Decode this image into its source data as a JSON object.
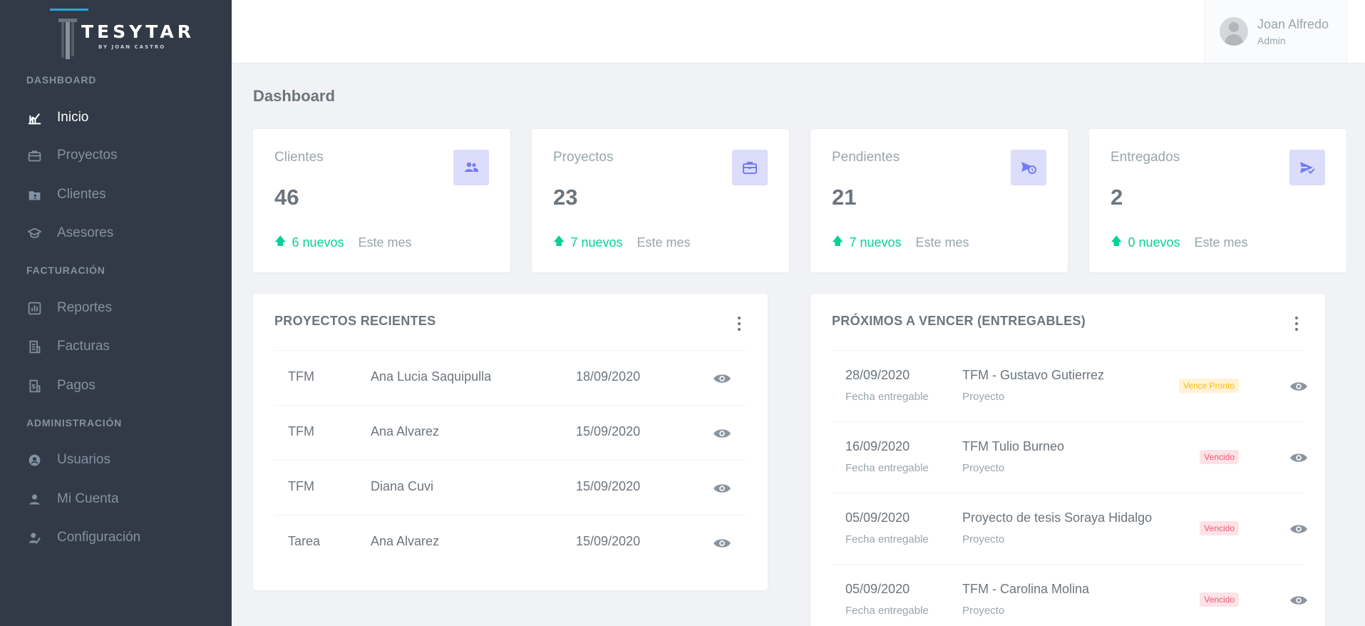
{
  "brand": {
    "name": "TESYTAR",
    "tagline": "BY JOAN CASTRO"
  },
  "sidebar": {
    "sections": [
      {
        "title": "DASHBOARD"
      },
      {
        "title": "FACTURACIÓN"
      },
      {
        "title": "ADMINISTRACIÓN"
      }
    ],
    "items": [
      {
        "label": "Inicio",
        "icon": "chart-icon",
        "active": true
      },
      {
        "label": "Proyectos",
        "icon": "briefcase-icon"
      },
      {
        "label": "Clientes",
        "icon": "folder-user-icon"
      },
      {
        "label": "Asesores",
        "icon": "graduation-cap-icon"
      },
      {
        "label": "Reportes",
        "icon": "bar-chart-icon"
      },
      {
        "label": "Facturas",
        "icon": "invoice-icon"
      },
      {
        "label": "Pagos",
        "icon": "payment-icon"
      },
      {
        "label": "Usuarios",
        "icon": "user-circle-icon"
      },
      {
        "label": "Mi Cuenta",
        "icon": "user-icon"
      },
      {
        "label": "Configuración",
        "icon": "user-settings-icon"
      }
    ]
  },
  "user": {
    "name": "Joan Alfredo",
    "role": "Admin"
  },
  "page": {
    "title": "Dashboard"
  },
  "stats": [
    {
      "label": "Clientes",
      "value": "46",
      "delta": "6 nuevos",
      "period": "Este mes",
      "icon": "users-icon"
    },
    {
      "label": "Proyectos",
      "value": "23",
      "delta": "7 nuevos",
      "period": "Este mes",
      "icon": "briefcase-icon"
    },
    {
      "label": "Pendientes",
      "value": "21",
      "delta": "7 nuevos",
      "period": "Este mes",
      "icon": "send-clock-icon"
    },
    {
      "label": "Entregados",
      "value": "2",
      "delta": "0 nuevos",
      "period": "Este mes",
      "icon": "send-check-icon"
    }
  ],
  "recent": {
    "title": "PROYECTOS RECIENTES",
    "rows": [
      {
        "type": "TFM",
        "name": "Ana Lucia Saquipulla",
        "date": "18/09/2020"
      },
      {
        "type": "TFM",
        "name": "Ana Alvarez",
        "date": "15/09/2020"
      },
      {
        "type": "TFM",
        "name": "Diana Cuvi",
        "date": "15/09/2020"
      },
      {
        "type": "Tarea",
        "name": "Ana Alvarez",
        "date": "15/09/2020"
      }
    ]
  },
  "due": {
    "title": "PRÓXIMOS A VENCER (ENTREGABLES)",
    "date_sub": "Fecha entregable",
    "name_sub": "Proyecto",
    "rows": [
      {
        "date": "28/09/2020",
        "name": "TFM - Gustavo Gutierrez",
        "status": "Vence Pronto",
        "status_kind": "warning"
      },
      {
        "date": "16/09/2020",
        "name": "TFM Tulio Burneo",
        "status": "Vencido",
        "status_kind": "danger"
      },
      {
        "date": "05/09/2020",
        "name": "Proyecto de tesis Soraya Hidalgo",
        "status": "Vencido",
        "status_kind": "danger"
      },
      {
        "date": "05/09/2020",
        "name": "TFM - Carolina Molina",
        "status": "Vencido",
        "status_kind": "danger"
      }
    ]
  },
  "colors": {
    "sidebar": "#313a46",
    "accent": "#727cf5",
    "success": "#0acf97",
    "warning": "#f9bc0b",
    "danger": "#f15776"
  }
}
